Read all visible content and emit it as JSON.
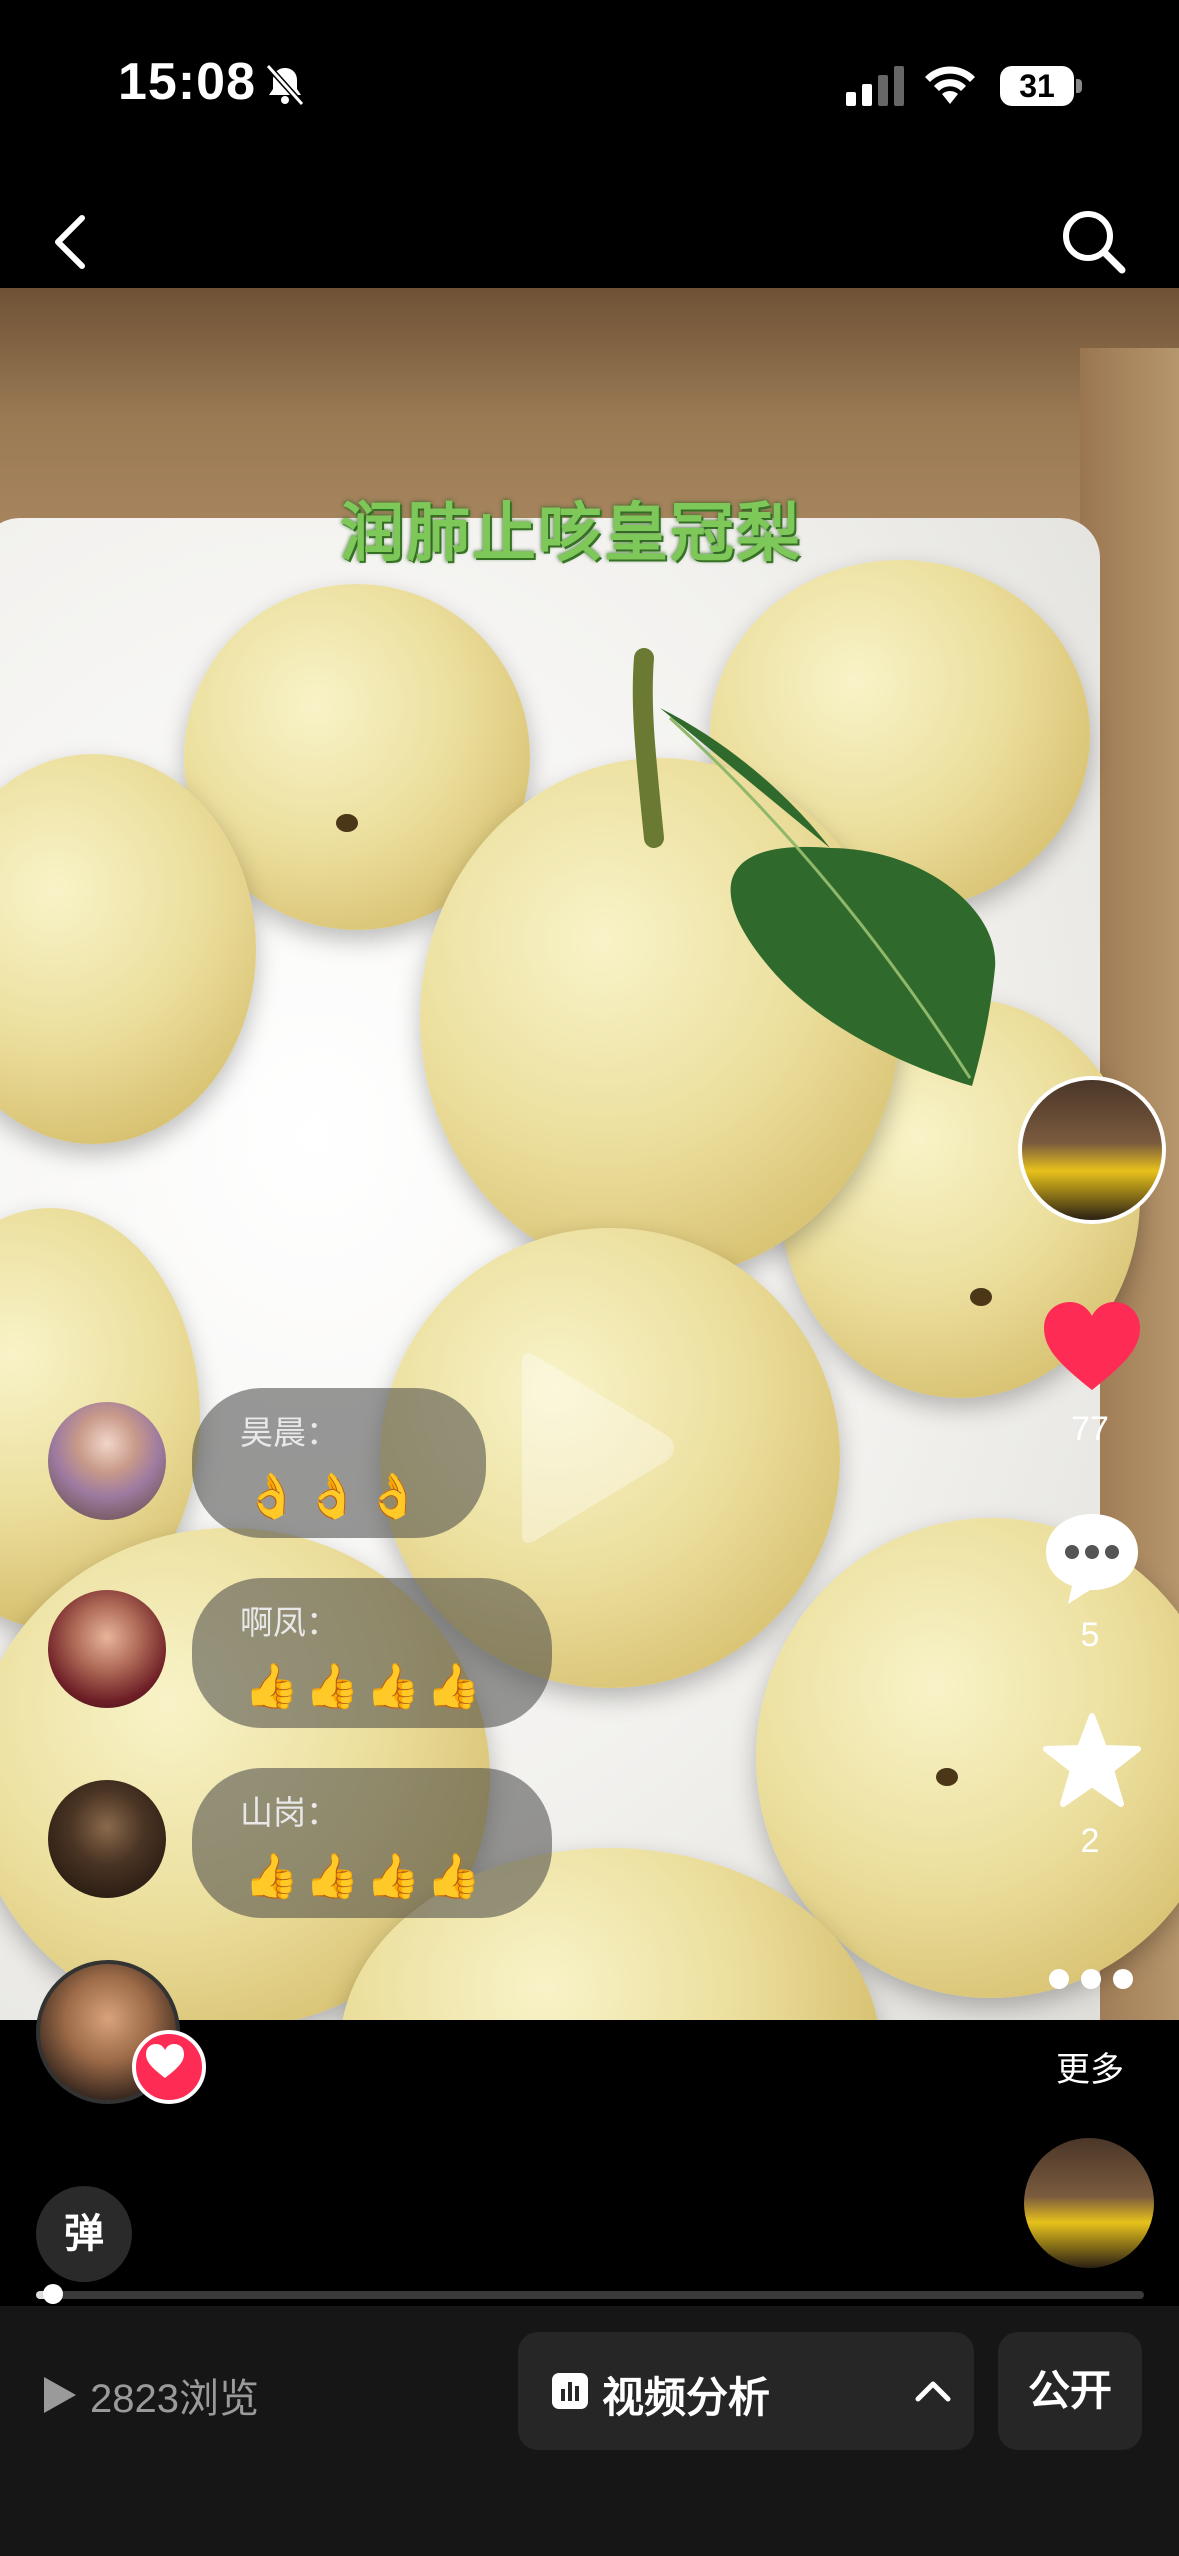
{
  "status_bar": {
    "time": "15:08",
    "battery": "31"
  },
  "video": {
    "overlay_title": "润肺止咳皇冠梨"
  },
  "actions": {
    "likes": "77",
    "comments": "5",
    "favorites": "2",
    "more_label": "更多"
  },
  "danmaku": [
    {
      "user": "昊晨：",
      "text": "👌👌👌"
    },
    {
      "user": "啊凤：",
      "text": "👍👍👍👍"
    },
    {
      "user": "山岗：",
      "text": "👍👍👍👍"
    }
  ],
  "bottom": {
    "danmaku_toggle": "弹",
    "progress_percent": 1.5,
    "views": "2823浏览",
    "analysis": "视频分析",
    "visibility": "公开"
  },
  "colors": {
    "like": "#fe2c55",
    "overlay_title": "#7ec85a",
    "footer_bg": "#161616"
  }
}
